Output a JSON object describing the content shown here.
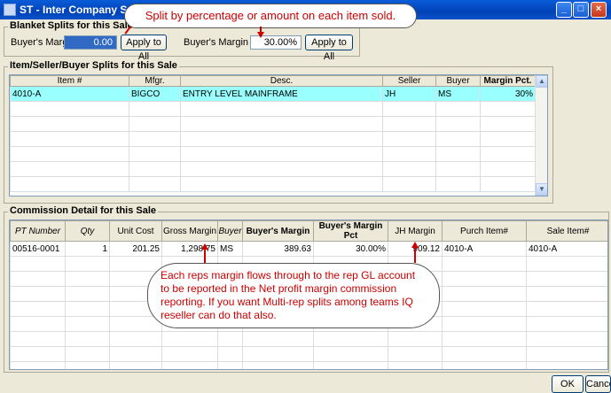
{
  "window": {
    "title": "ST - Inter Company Sale"
  },
  "callouts": {
    "top": "Split by percentage or amount on each item sold.",
    "middle": "Each reps margin flows through to the rep GL account to be reported in the Net profit margin commission reporting.  If you want Multi-rep splits among teams IQ reseller can do that also."
  },
  "blanket": {
    "title": "Blanket Splits for this Sale",
    "buyers_margin_label": "Buyer's Margin",
    "buyers_margin_value": "0.00",
    "apply_label": "Apply to All",
    "buyers_margin_pct_label": "Buyer's Margin Pct",
    "buyers_margin_pct_value": "30.00%",
    "apply_label_2": "Apply to All"
  },
  "item_splits": {
    "title": "Item/Seller/Buyer Splits for this Sale",
    "columns": [
      "Item #",
      "Mfgr.",
      "Desc.",
      "Seller",
      "Buyer",
      "Margin Pct."
    ],
    "rows": [
      [
        "4010-A",
        "BIGCO",
        "ENTRY LEVEL MAINFRAME",
        "JH",
        "MS",
        "30%"
      ]
    ]
  },
  "commission": {
    "title": "Commission Detail for this Sale",
    "columns": [
      "PT Number",
      "Qty",
      "Unit Cost",
      "Gross Margin",
      "Buyer",
      "Buyer's Margin",
      "Buyer's Margin Pct",
      "JH Margin",
      "Purch Item#",
      "Sale Item#"
    ],
    "rows": [
      [
        "00516-0001",
        "1",
        "201.25",
        "1,298.75",
        "MS",
        "389.63",
        "30.00%",
        "909.12",
        "4010-A",
        "4010-A"
      ]
    ]
  },
  "footer": {
    "ok": "OK",
    "cancel": "Cance"
  }
}
